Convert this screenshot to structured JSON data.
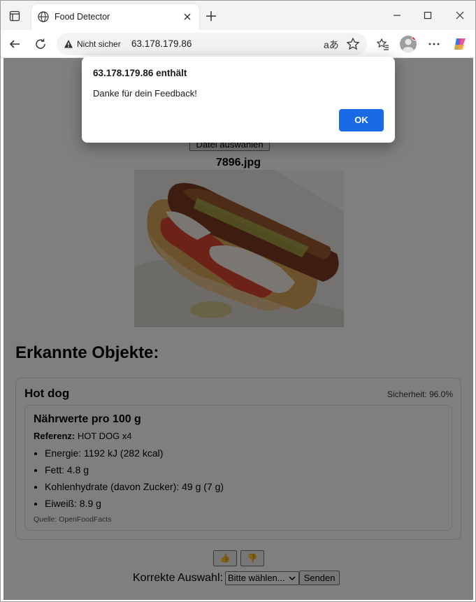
{
  "browser": {
    "tab_title": "Food Detector",
    "insecure_label": "Nicht sicher",
    "url": "63.178.179.86",
    "translate_glyph": "aあ"
  },
  "page": {
    "file_button": "Datei auswählen",
    "filename": "7896.jpg",
    "detected_heading": "Erkannte Objekte:",
    "detection": {
      "name": "Hot dog",
      "confidence": "Sicherheit: 96.0%",
      "nutrition": {
        "heading": "Nährwerte pro 100 g",
        "reference_label": "Referenz:",
        "reference_value": " HOT DOG x4",
        "items": [
          "Energie: 1192 kJ (282 kcal)",
          "Fett: 4.8 g",
          "Kohlenhydrate (davon Zucker): 49 g (7 g)",
          "Eiweiß: 8.9 g"
        ],
        "source": "Quelle: OpenFoodFacts"
      }
    },
    "feedback": {
      "thumbs_up": "👍",
      "thumbs_down": "👎",
      "correct_label": "Korrekte Auswahl:",
      "select_value": "Bitte wählen...",
      "send_button": "Senden"
    }
  },
  "dialog": {
    "title": "63.178.179.86 enthält",
    "message": "Danke für dein Feedback!",
    "ok_button": "OK"
  },
  "colors": {
    "accent": "#1a6ae6",
    "overlay": "#000000"
  }
}
